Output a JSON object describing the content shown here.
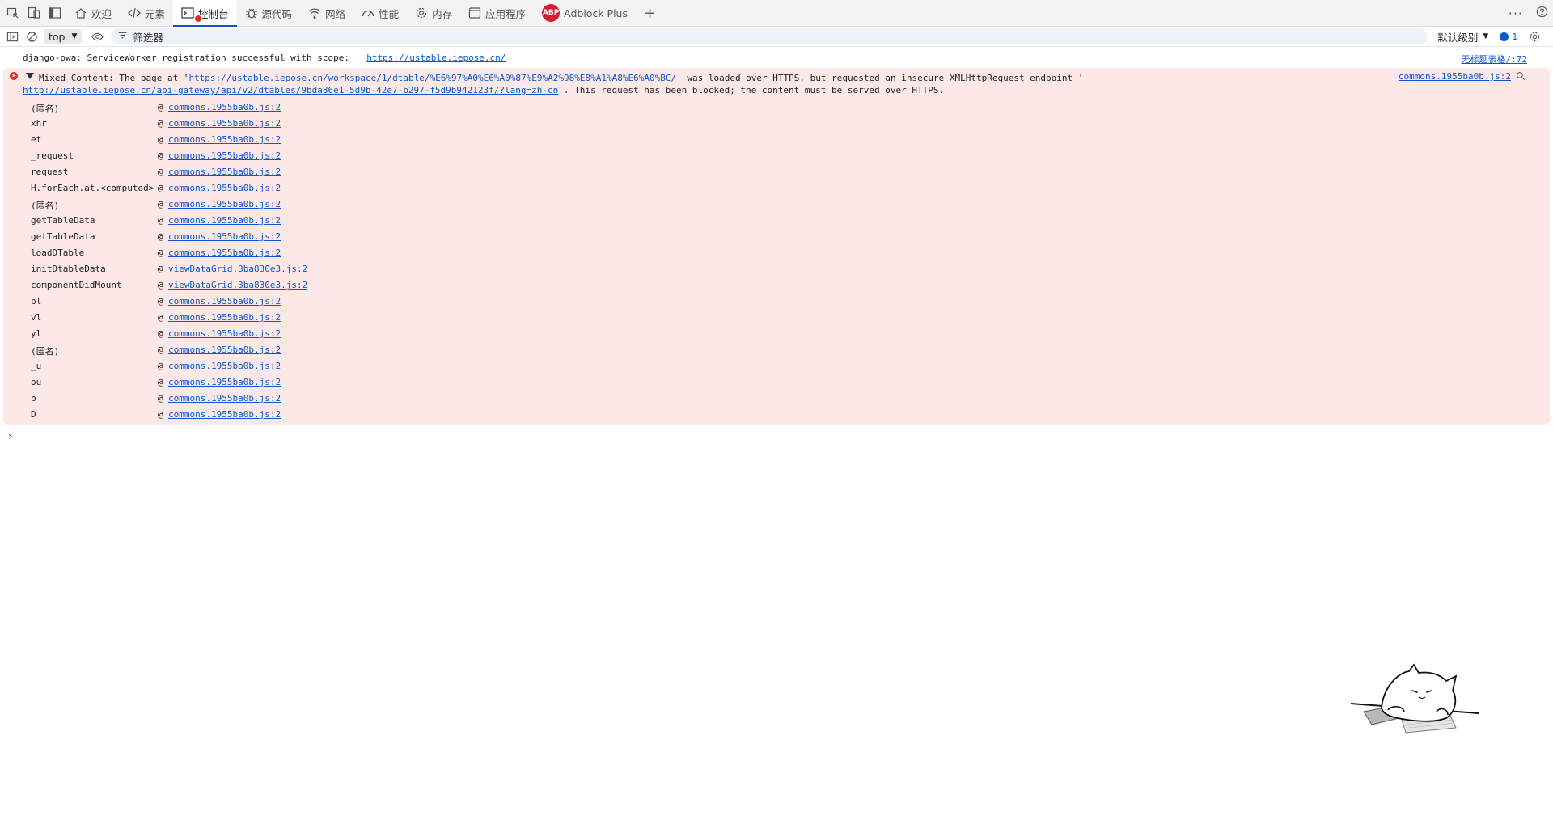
{
  "tabs": [
    {
      "label": "欢迎",
      "icon": "home-icon"
    },
    {
      "label": "元素",
      "icon": "code-icon"
    },
    {
      "label": "控制台",
      "icon": "console-icon",
      "active": true
    },
    {
      "label": "源代码",
      "icon": "bug-icon"
    },
    {
      "label": "网络",
      "icon": "wifi-icon"
    },
    {
      "label": "性能",
      "icon": "gauge-icon"
    },
    {
      "label": "内存",
      "icon": "gear-icon"
    },
    {
      "label": "应用程序",
      "icon": "app-window-icon"
    },
    {
      "label": "Adblock Plus",
      "icon": "abp-icon",
      "badge": "ABP"
    }
  ],
  "toolbar": {
    "context": "top",
    "filter_placeholder": "筛选器",
    "level": "默认级别",
    "message_count": "1"
  },
  "log": {
    "text": "django-pwa: ServiceWorker registration successful with scope:",
    "link": "https://ustable.iepose.cn/",
    "source": "无标题表格/:72"
  },
  "error": {
    "line1_prefix": "Mixed Content: The page at '",
    "page_url": "https://ustable.iepose.cn/workspace/1/dtable/%E6%97%A0%E6%A0%87%E9%A2%98%E8%A1%A8%E6%A0%BC/",
    "line1_suffix": "' was loaded over HTTPS, but requested an insecure XMLHttpRequest endpoint '",
    "endpoint_url": "http://ustable.iepose.cn/api-gateway/api/v2/dtables/9bda86e1-5d9b-42e7-b297-f5d9b942123f/?lang=zh-cn",
    "line2_suffix": "'. This request has been blocked; the content must be served over HTTPS.",
    "source": "commons.1955ba0b.js:2"
  },
  "stack": [
    {
      "fn": "(匿名)",
      "loc": "commons.1955ba0b.js:2"
    },
    {
      "fn": "xhr",
      "loc": "commons.1955ba0b.js:2"
    },
    {
      "fn": "et",
      "loc": "commons.1955ba0b.js:2"
    },
    {
      "fn": "_request",
      "loc": "commons.1955ba0b.js:2"
    },
    {
      "fn": "request",
      "loc": "commons.1955ba0b.js:2"
    },
    {
      "fn": "H.forEach.at.<computed>",
      "loc": "commons.1955ba0b.js:2"
    },
    {
      "fn": "(匿名)",
      "loc": "commons.1955ba0b.js:2"
    },
    {
      "fn": "getTableData",
      "loc": "commons.1955ba0b.js:2"
    },
    {
      "fn": "getTableData",
      "loc": "commons.1955ba0b.js:2"
    },
    {
      "fn": "loadDTable",
      "loc": "commons.1955ba0b.js:2"
    },
    {
      "fn": "initDtableData",
      "loc": "viewDataGrid.3ba830e3.js:2"
    },
    {
      "fn": "componentDidMount",
      "loc": "viewDataGrid.3ba830e3.js:2"
    },
    {
      "fn": "bl",
      "loc": "commons.1955ba0b.js:2"
    },
    {
      "fn": "vl",
      "loc": "commons.1955ba0b.js:2"
    },
    {
      "fn": "yl",
      "loc": "commons.1955ba0b.js:2"
    },
    {
      "fn": "(匿名)",
      "loc": "commons.1955ba0b.js:2"
    },
    {
      "fn": "_u",
      "loc": "commons.1955ba0b.js:2"
    },
    {
      "fn": "ou",
      "loc": "commons.1955ba0b.js:2"
    },
    {
      "fn": "b",
      "loc": "commons.1955ba0b.js:2"
    },
    {
      "fn": "D",
      "loc": "commons.1955ba0b.js:2"
    }
  ],
  "colors": {
    "accent": "#0b57d0",
    "error_bg": "#fce8e6",
    "error_icon": "#d93025"
  }
}
